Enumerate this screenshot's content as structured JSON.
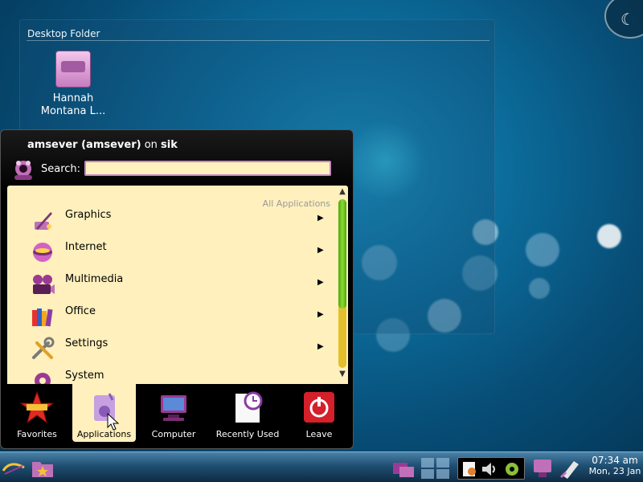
{
  "desktop_folder": {
    "title": "Desktop Folder",
    "icons": [
      {
        "label": "Hannah Montana L...",
        "icon": "drive-icon"
      }
    ]
  },
  "menu": {
    "user_name": "amsever (amsever)",
    "on_word": "on",
    "host": "sik",
    "search_label": "Search:",
    "search_value": "",
    "panel_header": "All Applications",
    "categories": [
      {
        "label": "Graphics",
        "icon": "graphics-icon"
      },
      {
        "label": "Internet",
        "icon": "internet-icon"
      },
      {
        "label": "Multimedia",
        "icon": "multimedia-icon"
      },
      {
        "label": "Office",
        "icon": "office-icon"
      },
      {
        "label": "Settings",
        "icon": "settings-icon"
      },
      {
        "label": "System",
        "icon": "system-icon"
      }
    ],
    "scroll_position": 0,
    "tabs": [
      {
        "label": "Favorites",
        "icon": "star-icon",
        "active": false
      },
      {
        "label": "Applications",
        "icon": "applications-icon",
        "active": true
      },
      {
        "label": "Computer",
        "icon": "computer-icon",
        "active": false
      },
      {
        "label": "Recently Used",
        "icon": "clock-document-icon",
        "active": false
      },
      {
        "label": "Leave",
        "icon": "power-icon",
        "active": false
      }
    ]
  },
  "taskbar": {
    "clock_time": "07:34 am",
    "clock_date": "Mon, 23 Jan"
  },
  "colors": {
    "panel_bg": "#fff0bd",
    "search_bg": "#fff2bc",
    "scroll_thumb": "#6cc223",
    "scroll_track": "#e3c02b",
    "leave_red": "#d4202a"
  }
}
